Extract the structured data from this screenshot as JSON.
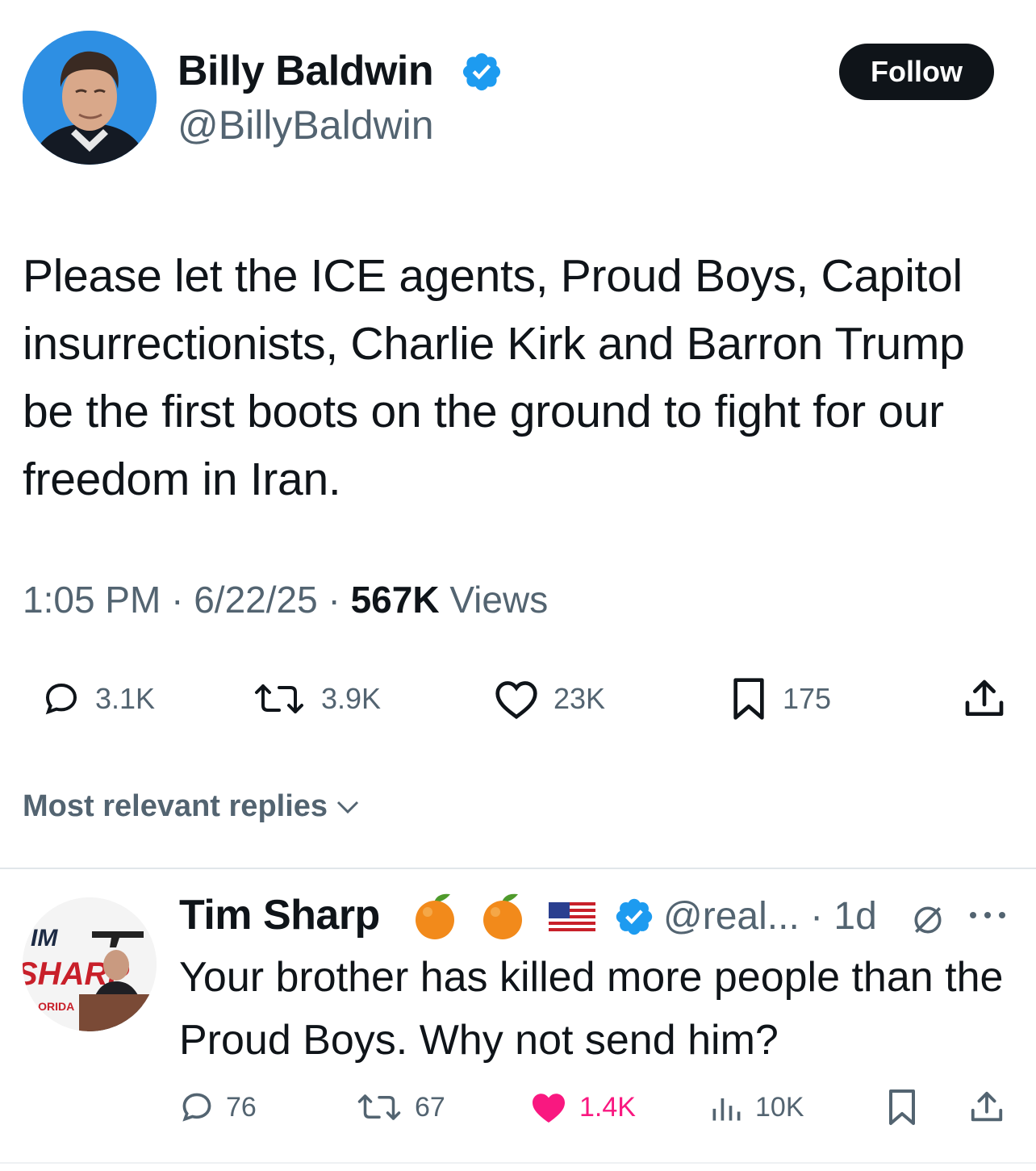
{
  "tweet": {
    "author_name": "Billy Baldwin",
    "handle": "@BillyBaldwin",
    "follow_label": "Follow",
    "text": "Please let the ICE agents, Proud Boys, Capitol insurrectionists, Charlie Kirk and Barron Trump be the first boots on the ground to fight for our freedom in Iran.",
    "time": "1:05 PM",
    "date": "6/22/25",
    "separator": "·",
    "views_count": "567K",
    "views_label": "Views",
    "stats": {
      "replies": "3.1K",
      "reposts": "3.9K",
      "likes": "23K",
      "bookmarks": "175"
    },
    "icons": [
      "reply-icon",
      "repost-icon",
      "like-icon",
      "bookmark-icon",
      "share-icon",
      "verified-icon"
    ]
  },
  "replies_sort_label": "Most relevant replies",
  "reply": {
    "author_name": "Tim Sharp",
    "handle_time": "@real... · 1d",
    "text": "Your brother has killed more people than the Proud Boys. Why not send him?",
    "avatar_text": {
      "line1": "IM",
      "line2": "SHARP",
      "line3": "FLORIDA"
    },
    "stats": {
      "replies": "76",
      "reposts": "67",
      "likes": "1.4K",
      "views": "10K"
    },
    "name_badges": [
      "orange-emoji",
      "orange-emoji",
      "us-flag-emoji",
      "verified-icon"
    ],
    "colors": {
      "like_active": "#f91880"
    }
  },
  "colors": {
    "verified": "#1d9bf0",
    "secondary_text": "#536471",
    "primary_text": "#0f1419"
  }
}
